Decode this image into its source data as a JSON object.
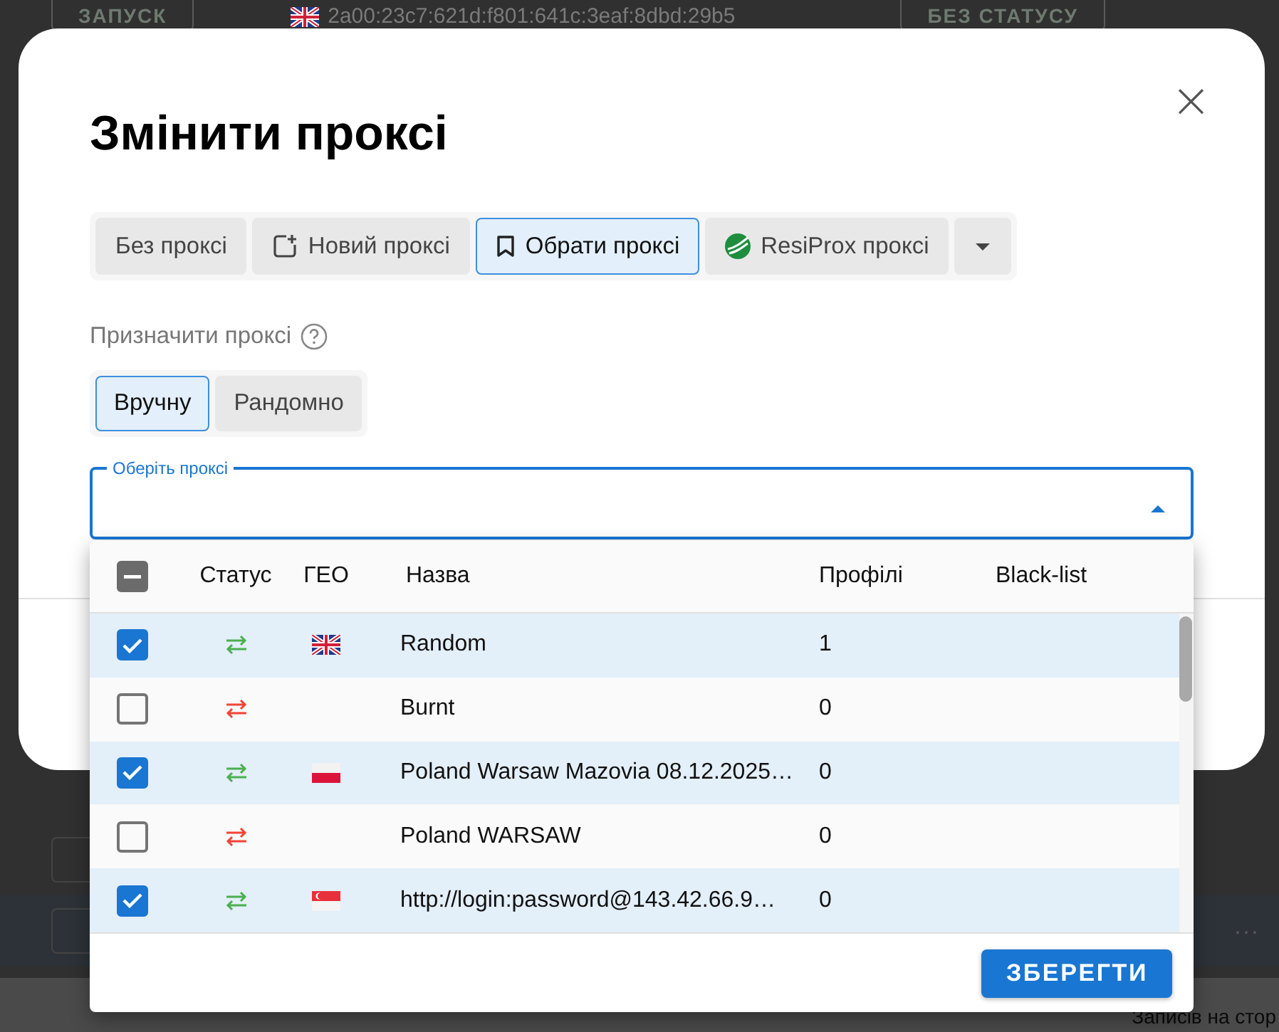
{
  "background": {
    "run_button": "ЗАПУСК",
    "address": {
      "geo": {
        "kind": "gb"
      },
      "text": "2a00:23c7:621d:f801:641c:3eaf:8dbd:29b5"
    },
    "status_button": "БЕЗ СТАТУСУ",
    "more": "···",
    "pager_label": "Записів на стор"
  },
  "modal": {
    "title": "Змінити проксі",
    "close": "×",
    "tabs": [
      {
        "label": "Без проксі",
        "kind": "plain",
        "selected": false
      },
      {
        "label": "Новий проксі",
        "kind": "new",
        "selected": false
      },
      {
        "label": "Обрати проксі",
        "kind": "saved",
        "selected": true
      },
      {
        "label": "ResiProx проксі",
        "kind": "provider",
        "selected": false
      }
    ],
    "assign_label": "Призначити проксі",
    "modes": [
      {
        "label": "Вручну",
        "selected": true
      },
      {
        "label": "Рандомно",
        "selected": false
      }
    ],
    "select": {
      "label": "Оберіть проксі",
      "expanded": true
    },
    "popup": {
      "select_all_indeterminate": true,
      "columns": [
        "Статус",
        "ГЕО",
        "Назва",
        "Профілі",
        "Black-list"
      ],
      "rows": [
        {
          "checked": true,
          "online": true,
          "geo": {
            "kind": "gb"
          },
          "name": "Random",
          "profiles": "1"
        },
        {
          "checked": false,
          "online": false,
          "name": "Burnt",
          "profiles": "0"
        },
        {
          "checked": true,
          "online": true,
          "geo": {
            "kind": "pl"
          },
          "name": "Poland Warsaw Mazovia 08.12.2025…",
          "profiles": "0"
        },
        {
          "checked": false,
          "online": false,
          "name": "Poland WARSAW",
          "profiles": "0"
        },
        {
          "checked": true,
          "online": true,
          "geo": {
            "kind": "sg"
          },
          "name": "http://login:password@143.42.66.9…",
          "profiles": "0"
        }
      ],
      "save_button": "ЗБЕРЕГТИ"
    }
  }
}
